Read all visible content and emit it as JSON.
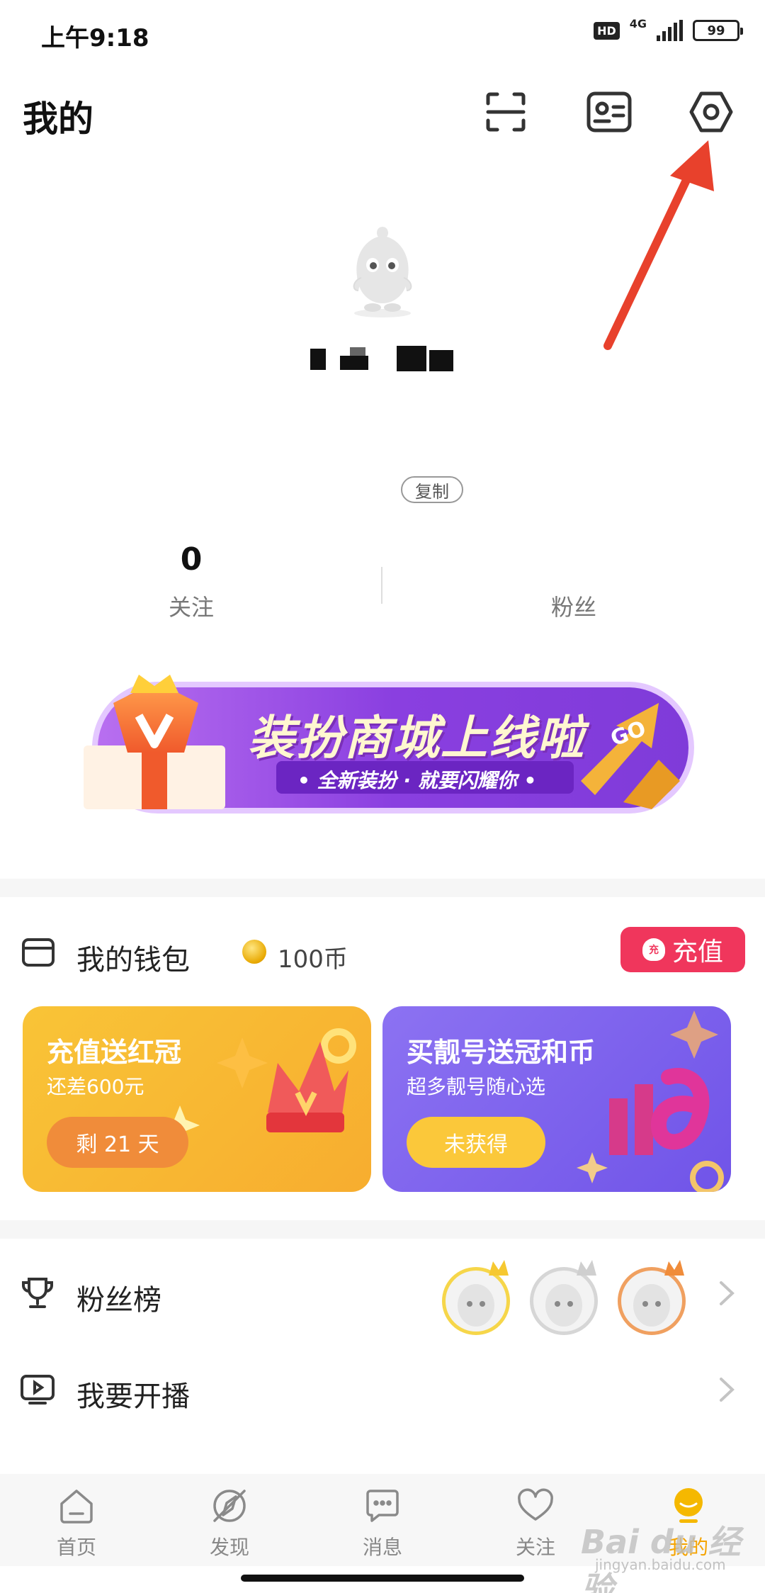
{
  "status_bar": {
    "time": "上午9:18",
    "hd": "HD",
    "network": "4G",
    "battery": "99"
  },
  "header": {
    "title": "我的",
    "scan_icon": "scan-icon",
    "id_card_icon": "id-card-icon",
    "settings_icon": "settings-hexagon-icon"
  },
  "profile": {
    "copy_label": "复制",
    "stats": [
      {
        "value": "0",
        "label": "关注"
      },
      {
        "value": "",
        "label": "粉丝"
      }
    ]
  },
  "banner": {
    "title": "装扮商城上线啦",
    "subtitle": "• 全新装扮 · 就要闪耀你 •",
    "go_label": "GO"
  },
  "wallet": {
    "title": "我的钱包",
    "coins": "100币",
    "recharge_label": "充值",
    "recharge_badge": "充"
  },
  "cards": [
    {
      "title": "充值送红冠",
      "subtitle": "还差600元",
      "button": "剩 21 天"
    },
    {
      "title": "买靓号送冠和币",
      "subtitle": "超多靓号随心选",
      "button": "未获得"
    }
  ],
  "list": [
    {
      "label": "粉丝榜",
      "icon": "trophy-icon"
    },
    {
      "label": "我要开播",
      "icon": "live-tv-icon"
    }
  ],
  "bottom_nav": [
    {
      "label": "首页",
      "icon": "home-icon",
      "active": false
    },
    {
      "label": "发现",
      "icon": "compass-icon",
      "active": false
    },
    {
      "label": "消息",
      "icon": "message-icon",
      "active": false
    },
    {
      "label": "关注",
      "icon": "heart-icon",
      "active": false
    },
    {
      "label": "我的",
      "icon": "profile-icon",
      "active": true
    }
  ],
  "watermark": {
    "text": "Bai du 经验",
    "sub": "jingyan.baidu.com"
  },
  "colors": {
    "accent": "#f5a400",
    "recharge": "#f0365c",
    "banner": "#8a3fe0",
    "arrow": "#e8412c"
  }
}
